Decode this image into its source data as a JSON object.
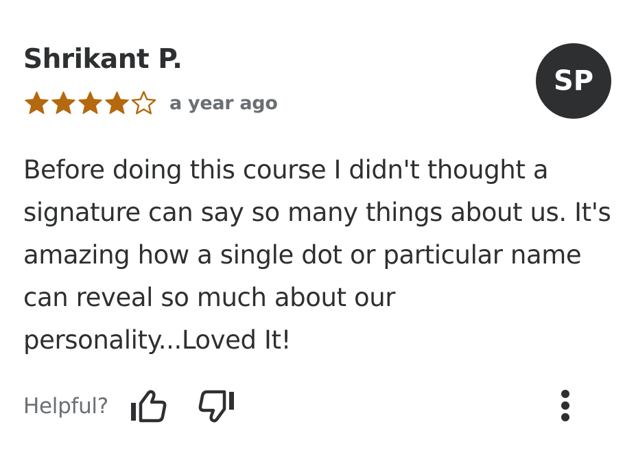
{
  "review": {
    "reviewer_name": "Shrikant P.",
    "avatar_initials": "SP",
    "rating": 4,
    "rating_max": 5,
    "timestamp": "a year ago",
    "body": "Before doing this course I didn't thought a signature can say so many things about us. It's amazing how a single dot or particular name can reveal so much about our personality...Loved It!"
  },
  "feedback": {
    "helpful_label": "Helpful?",
    "icons": [
      "thumbs-up-icon",
      "thumbs-down-icon",
      "more-vertical-icon"
    ]
  },
  "colors": {
    "star": "#b4690e",
    "text": "#2d2f31",
    "muted": "#6a6f73",
    "avatar_bg": "#2d2f31",
    "avatar_text": "#ffffff"
  }
}
